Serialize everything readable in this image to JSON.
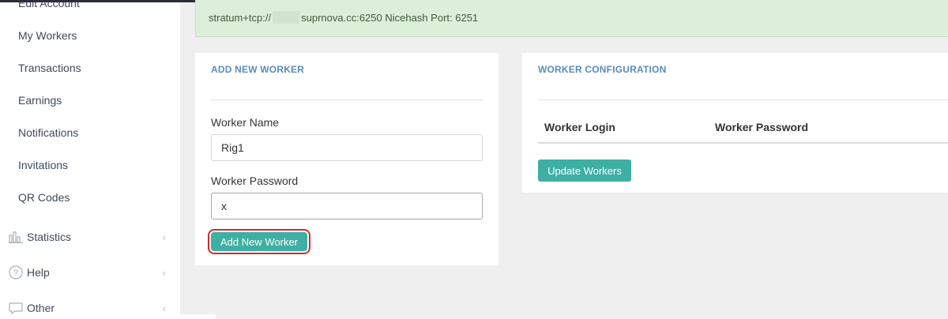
{
  "sidebar": {
    "items": [
      {
        "label": "Edit Account"
      },
      {
        "label": "My Workers"
      },
      {
        "label": "Transactions"
      },
      {
        "label": "Earnings"
      },
      {
        "label": "Notifications"
      },
      {
        "label": "Invitations"
      },
      {
        "label": "QR Codes"
      }
    ],
    "groups": [
      {
        "label": "Statistics",
        "icon": "bar-chart-icon",
        "chevron": "‹"
      },
      {
        "label": "Help",
        "icon": "question-circle-icon",
        "chevron": "‹"
      },
      {
        "label": "Other",
        "icon": "chat-bubble-icon",
        "chevron": "‹"
      }
    ]
  },
  "notice": {
    "prefix": "stratum+tcp://",
    "suffix": "suprnova.cc:6250 Nicehash Port: 6251"
  },
  "add_worker": {
    "title": "ADD NEW WORKER",
    "name_label": "Worker Name",
    "name_value": "Rig1",
    "password_label": "Worker Password",
    "password_value": "x",
    "button_label": "Add New Worker"
  },
  "worker_config": {
    "title": "WORKER CONFIGURATION",
    "columns": [
      "Worker Login",
      "Worker Password"
    ],
    "button_label": "Update Workers"
  },
  "colors": {
    "accent_teal": "#3fafa3",
    "title_blue": "#5b8bb8",
    "notice_bg": "#dcefd8",
    "highlight_red": "#d22a2a"
  }
}
